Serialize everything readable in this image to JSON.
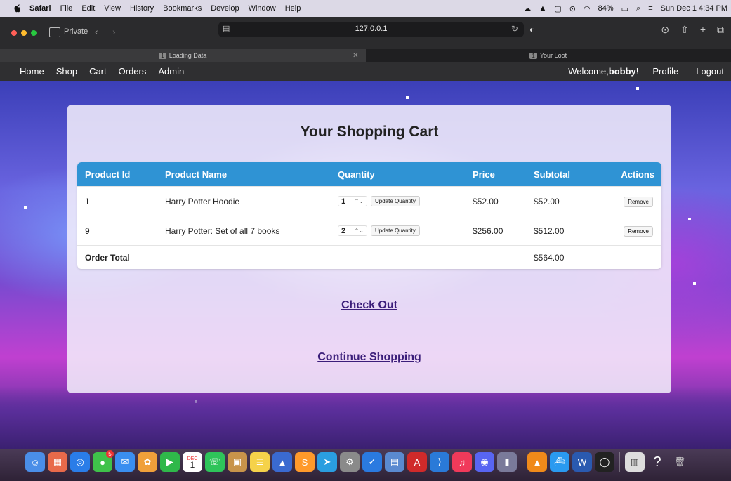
{
  "menubar": {
    "app_name": "Safari",
    "items": [
      "File",
      "Edit",
      "View",
      "History",
      "Bookmarks",
      "Develop",
      "Window",
      "Help"
    ],
    "battery": "84%",
    "datetime": "Sun Dec 1  4:34 PM"
  },
  "browser": {
    "private_label": "Private",
    "url": "127.0.0.1",
    "tabs": [
      {
        "num": "1",
        "title": "Loading Data"
      },
      {
        "num": "1",
        "title": "Your Loot"
      }
    ]
  },
  "nav": {
    "links": [
      "Home",
      "Shop",
      "Cart",
      "Orders",
      "Admin"
    ],
    "welcome_prefix": "Welcome,",
    "username": "bobby",
    "welcome_suffix": "!",
    "profile": "Profile",
    "logout": "Logout"
  },
  "cart": {
    "title": "Your Shopping Cart",
    "headers": [
      "Product Id",
      "Product Name",
      "Quantity",
      "Price",
      "Subtotal",
      "Actions"
    ],
    "rows": [
      {
        "id": "1",
        "name": "Harry Potter Hoodie",
        "qty": "1",
        "price": "$52.00",
        "subtotal": "$52.00"
      },
      {
        "id": "9",
        "name": "Harry Potter: Set of all 7 books",
        "qty": "2",
        "price": "$256.00",
        "subtotal": "$512.00"
      }
    ],
    "update_label": "Update Quantity",
    "remove_label": "Remove",
    "total_label": "Order Total",
    "total_value": "$564.00",
    "checkout_label": "Check Out",
    "continue_label": "Continue Shopping"
  },
  "dock": {
    "calendar_month": "DEC",
    "calendar_day": "1",
    "messages_badge": "5"
  },
  "colors": {
    "table_header": "#2f93d4",
    "link": "#3b1e7a"
  }
}
